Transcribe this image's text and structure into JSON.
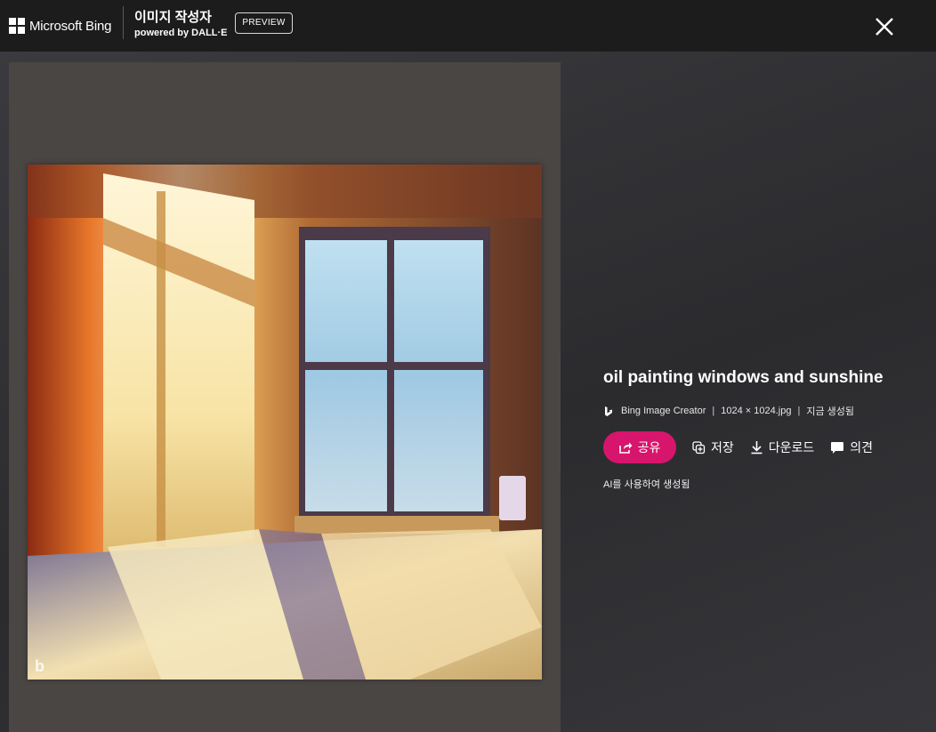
{
  "header": {
    "brand": "Microsoft Bing",
    "app_title": "이미지 작성자",
    "powered_by": "powered by DALL·E",
    "badge": "PREVIEW"
  },
  "icons": {
    "logo": "microsoft-windows-logo",
    "close": "close-icon",
    "bing": "bing-b-icon",
    "share": "share-icon",
    "save": "save-collection-icon",
    "download": "download-icon",
    "feedback": "comment-icon"
  },
  "image": {
    "title": "oil painting windows and sunshine",
    "source": "Bing Image Creator",
    "file_info": "1024 × 1024.jpg",
    "generated": "지금 생성됨",
    "ai_note": "AI를 사용하여 생성됨"
  },
  "actions": {
    "share": "공유",
    "save": "저장",
    "download": "다운로드",
    "feedback": "의견"
  },
  "colors": {
    "share_button": "#d8156c",
    "topbar": "#1c1c1c",
    "image_pane": "#4a4644"
  }
}
